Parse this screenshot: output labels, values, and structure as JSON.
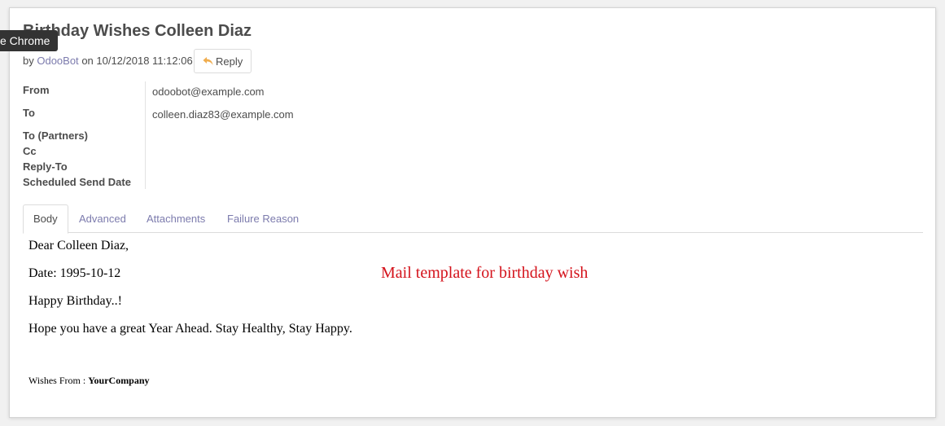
{
  "message": {
    "title": "Birthday Wishes Colleen Diaz",
    "meta_by": "by",
    "author": "OdooBot",
    "meta_on": "on 10/12/2018 11:12:06",
    "reply_label": "Reply"
  },
  "fields": [
    {
      "label": "From",
      "value": "odoobot@example.com"
    },
    {
      "label": "To",
      "value": "colleen.diaz83@example.com"
    },
    {
      "label": "To (Partners)",
      "value": ""
    },
    {
      "label": "Cc",
      "value": ""
    },
    {
      "label": "Reply-To",
      "value": ""
    },
    {
      "label": "Scheduled Send Date",
      "value": ""
    }
  ],
  "tabs": [
    {
      "label": "Body",
      "active": true
    },
    {
      "label": "Advanced",
      "active": false
    },
    {
      "label": "Attachments",
      "active": false
    },
    {
      "label": "Failure Reason",
      "active": false
    }
  ],
  "body": {
    "greeting": "Dear Colleen Diaz,",
    "date_line": "Date: 1995-10-12",
    "wish": "Happy Birthday..!",
    "closing": "Hope you have a great Year Ahead. Stay Healthy, Stay Happy.",
    "wishes_prefix": "Wishes From :",
    "company": "YourCompany"
  },
  "annotation": "Mail template for birthday wish",
  "tooltip": "e Chrome",
  "colors": {
    "link": "#7c7bad",
    "annotation": "#d4121b",
    "reply_icon": "#f0ad4e"
  }
}
